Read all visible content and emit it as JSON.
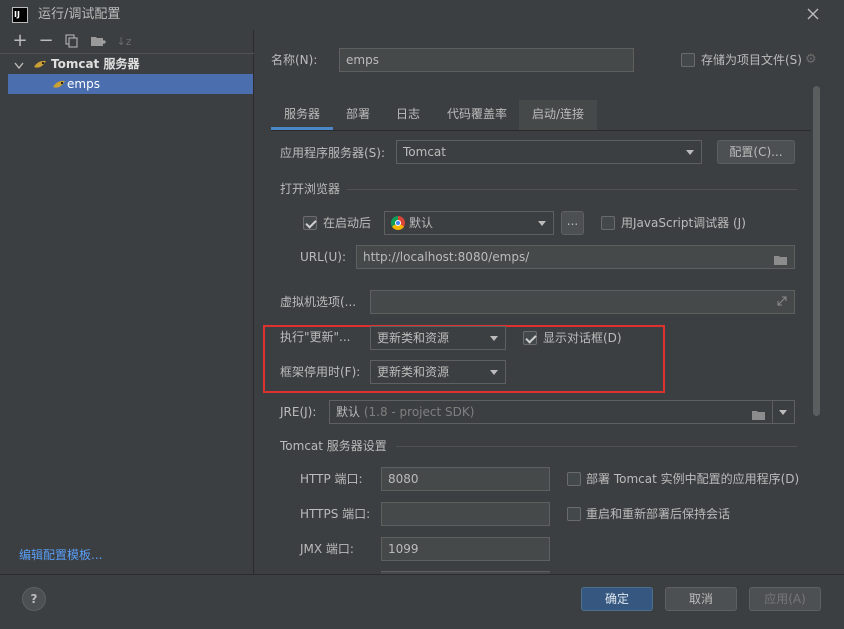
{
  "window": {
    "title": "运行/调试配置",
    "app_icon": "IJ",
    "close_icon": "close-icon"
  },
  "toolbar": {
    "icons": [
      "add-icon",
      "remove-icon",
      "copy-icon",
      "new-folder-icon",
      "sort-icon"
    ]
  },
  "tree": {
    "group_label": "Tomcat 服务器",
    "item_label": "emps",
    "edit_templates_link": "编辑配置模板..."
  },
  "form": {
    "name_label": "名称(N):",
    "name_value": "emps",
    "store_as_project_label": "存储为项目文件(S)",
    "tabs": [
      {
        "label": "服务器",
        "active": true
      },
      {
        "label": "部署",
        "active": false
      },
      {
        "label": "日志",
        "active": false
      },
      {
        "label": "代码覆盖率",
        "active": false
      },
      {
        "label": "启动/连接",
        "active": false
      }
    ],
    "app_server_label": "应用程序服务器(S):",
    "app_server_value": "Tomcat",
    "configure_button": "配置(C)...",
    "open_browser_section": "打开浏览器",
    "after_launch_label": "在启动后",
    "after_launch_checked": true,
    "browser_value": "默认",
    "browse_button": "...",
    "js_debugger_label": "用JavaScript调试器 (J)",
    "js_debugger_checked": false,
    "url_label": "URL(U):",
    "url_value": "http://localhost:8080/emps/",
    "vm_options_label": "虚拟机选项(...",
    "vm_options_value": "",
    "on_update_label": "执行\"更新\"...",
    "on_update_value": "更新类和资源",
    "show_dialog_label": "显示对话框(D)",
    "show_dialog_checked": true,
    "on_frame_deactivation_label": "框架停用时(F):",
    "on_frame_deactivation_value": "更新类和资源",
    "jre_label": "JRE(J):",
    "jre_value": "默认",
    "jre_hint": " (1.8 - project SDK)",
    "tomcat_settings_section": "Tomcat 服务器设置",
    "http_port_label": "HTTP 端口:",
    "http_port_value": "8080",
    "https_port_label": "HTTPS 端口:",
    "https_port_value": "",
    "jmx_port_label": "JMX 端口:",
    "jmx_port_value": "1099",
    "deploy_configured_label": "部署 Tomcat 实例中配置的应用程序(D)",
    "deploy_configured_checked": false,
    "preserve_sessions_label": "重启和重新部署后保持会话",
    "preserve_sessions_checked": false
  },
  "footer": {
    "help_icon": "help-icon",
    "help_glyph": "?",
    "ok_button": "确定",
    "cancel_button": "取消",
    "apply_button": "应用(A)"
  },
  "colors": {
    "accent": "#4a88c7",
    "selection": "#4b6eaf",
    "highlight_box": "#e03131",
    "primary_button": "#365880"
  }
}
